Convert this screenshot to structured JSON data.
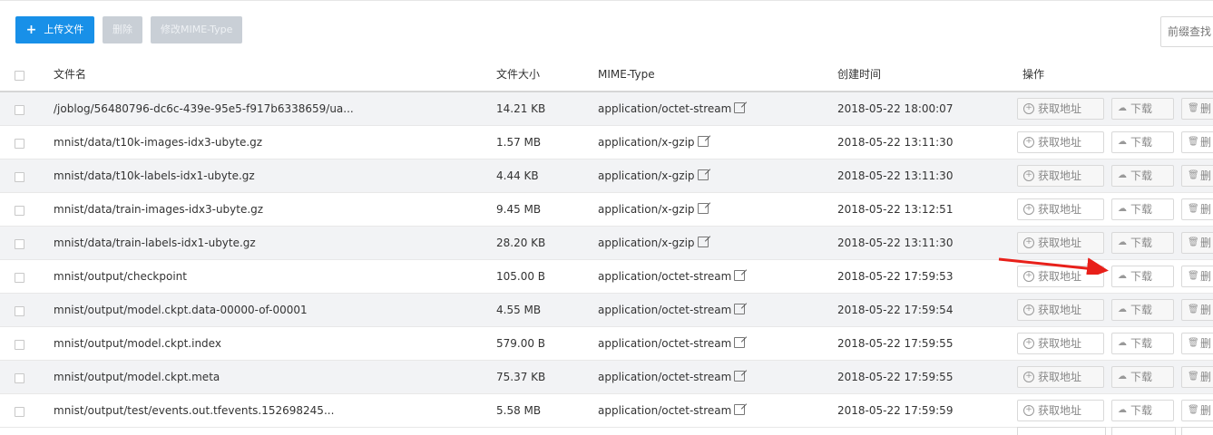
{
  "toolbar": {
    "upload_label": "上传文件",
    "delete_label": "删除",
    "modify_mime_label": "修改MIME-Type"
  },
  "search": {
    "placeholder": "前缀查找"
  },
  "table": {
    "columns": [
      "文件名",
      "文件大小",
      "MIME-Type",
      "创建时间",
      "操作"
    ],
    "action_labels": {
      "get_url": "获取地址",
      "download": "下载",
      "delete": "删"
    },
    "rows": [
      {
        "name": "/joblog/56480796-dc6c-439e-95e5-f917b6338659/ua...",
        "size": "14.21 KB",
        "mime": "application/octet-stream",
        "time": "2018-05-22 18:00:07"
      },
      {
        "name": "mnist/data/t10k-images-idx3-ubyte.gz",
        "size": "1.57 MB",
        "mime": "application/x-gzip",
        "time": "2018-05-22 13:11:30"
      },
      {
        "name": "mnist/data/t10k-labels-idx1-ubyte.gz",
        "size": "4.44 KB",
        "mime": "application/x-gzip",
        "time": "2018-05-22 13:11:30"
      },
      {
        "name": "mnist/data/train-images-idx3-ubyte.gz",
        "size": "9.45 MB",
        "mime": "application/x-gzip",
        "time": "2018-05-22 13:12:51"
      },
      {
        "name": "mnist/data/train-labels-idx1-ubyte.gz",
        "size": "28.20 KB",
        "mime": "application/x-gzip",
        "time": "2018-05-22 13:11:30"
      },
      {
        "name": "mnist/output/checkpoint",
        "size": "105.00 B",
        "mime": "application/octet-stream",
        "time": "2018-05-22 17:59:53"
      },
      {
        "name": "mnist/output/model.ckpt.data-00000-of-00001",
        "size": "4.55 MB",
        "mime": "application/octet-stream",
        "time": "2018-05-22 17:59:54"
      },
      {
        "name": "mnist/output/model.ckpt.index",
        "size": "579.00 B",
        "mime": "application/octet-stream",
        "time": "2018-05-22 17:59:55"
      },
      {
        "name": "mnist/output/model.ckpt.meta",
        "size": "75.37 KB",
        "mime": "application/octet-stream",
        "time": "2018-05-22 17:59:55"
      },
      {
        "name": "mnist/output/test/events.out.tfevents.152698245...",
        "size": "5.58 MB",
        "mime": "application/octet-stream",
        "time": "2018-05-22 17:59:59"
      }
    ]
  },
  "annotation": {
    "color": "#e8201a"
  },
  "colors": {
    "primary": "#1890e8",
    "disabled": "#c9cfd6",
    "stripe": "#f2f3f5"
  }
}
